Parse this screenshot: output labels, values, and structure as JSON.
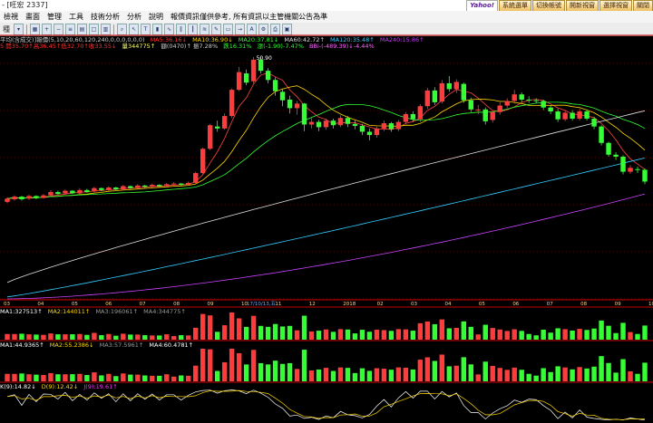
{
  "window": {
    "title": "- [旺宏 2337]"
  },
  "top_buttons": [
    "Yahoo!",
    "系統選單",
    "切換帳號",
    "開新視窗",
    "選擇視窗",
    "關閉"
  ],
  "menu": [
    "檢視",
    "畫面",
    "管理",
    "工具",
    "技術分析",
    "分析",
    "說明",
    "報價資訊僅供參考, 所有資訊以主管機關公告為準"
  ],
  "toolbar": {
    "combo_label": "種"
  },
  "indicator_lines": {
    "price_header": [
      {
        "text": "平均(含成交)]報價(5,10,20,60,120,240,0,0,0,0,0,0)",
        "color": "#cccccc"
      },
      {
        "text": "MA5:36.16↓",
        "color": "#ff3333"
      },
      {
        "text": "MA10:36.90↓",
        "color": "#ffd700"
      },
      {
        "text": "MA20:37.81↓",
        "color": "#33ff33"
      },
      {
        "text": "MA60:42.72↑",
        "color": "#dddddd"
      },
      {
        "text": "MA120:35.48↑",
        "color": "#33ccff"
      },
      {
        "text": "MA240:15.86↑",
        "color": "#cc33ff"
      }
    ],
    "quote_line": [
      {
        "text": "5 開35.70↑高36.45↑低32.70↑收33.55↓",
        "color": "#ff3333"
      },
      {
        "text": "量344775↑",
        "color": "#ffff66"
      },
      {
        "text": "額(0470)↑ 振7.28%",
        "color": "#cccccc"
      },
      {
        "text": "跌16.31%",
        "color": "#33ff33"
      },
      {
        "text": "漲(-1.90)-7.47%",
        "color": "#33ff33"
      },
      {
        "text": "BBi-(-489.39)↓-4.44%",
        "color": "#ff66ff"
      }
    ],
    "volume_header": [
      {
        "text": "MA1:327513↑",
        "color": "#ffffff"
      },
      {
        "text": "MA2:144011↑",
        "color": "#ffd700"
      },
      {
        "text": "MA3:196061↑",
        "color": "#999999"
      },
      {
        "text": "MA4:344775↑",
        "color": "#999999"
      }
    ],
    "second_header": [
      {
        "text": "MA1:44.9365↑",
        "color": "#ffffff"
      },
      {
        "text": "MA2:55.2386↓",
        "color": "#ffd700"
      },
      {
        "text": "MA3:57.5961↑",
        "color": "#999999"
      },
      {
        "text": "MA4:60.4781↑",
        "color": "#ffffff"
      }
    ],
    "kd_header": [
      {
        "text": "K(9):14.82↓",
        "color": "#ffffff"
      },
      {
        "text": "D(9):12.42↓",
        "color": "#ffd700"
      },
      {
        "text": "J(9):19.61↑",
        "color": "#ff33ff"
      }
    ]
  },
  "chart_data": {
    "type": "candlestick",
    "peak_label": "50.90",
    "date_axis": [
      "03",
      "04",
      "05",
      "06",
      "07",
      "08",
      "09",
      "10",
      "11",
      "12",
      "2018",
      "02",
      "03",
      "04",
      "05",
      "06",
      "07",
      "08",
      "09",
      "10"
    ],
    "cursor_label": "17/10/13,五",
    "candles": [
      {
        "o": 28.8,
        "c": 29.3,
        "h": 29.5,
        "l": 28.6
      },
      {
        "o": 29.2,
        "c": 29.6,
        "h": 29.8,
        "l": 29.0
      },
      {
        "o": 29.6,
        "c": 29.2,
        "h": 29.7,
        "l": 29.0
      },
      {
        "o": 29.3,
        "c": 29.7,
        "h": 29.9,
        "l": 29.1
      },
      {
        "o": 29.7,
        "c": 29.4,
        "h": 29.8,
        "l": 29.2
      },
      {
        "o": 29.4,
        "c": 29.8,
        "h": 30.0,
        "l": 29.3
      },
      {
        "o": 29.8,
        "c": 30.3,
        "h": 30.6,
        "l": 29.7
      },
      {
        "o": 30.3,
        "c": 30.0,
        "h": 30.5,
        "l": 29.9
      },
      {
        "o": 30.1,
        "c": 30.5,
        "h": 30.7,
        "l": 29.9
      },
      {
        "o": 30.5,
        "c": 30.1,
        "h": 30.6,
        "l": 30.0
      },
      {
        "o": 30.1,
        "c": 30.6,
        "h": 30.9,
        "l": 30.0
      },
      {
        "o": 30.6,
        "c": 30.3,
        "h": 30.8,
        "l": 30.2
      },
      {
        "o": 30.4,
        "c": 30.9,
        "h": 31.1,
        "l": 30.2
      },
      {
        "o": 30.9,
        "c": 30.6,
        "h": 31.0,
        "l": 30.4
      },
      {
        "o": 30.6,
        "c": 31.0,
        "h": 31.2,
        "l": 30.5
      },
      {
        "o": 31.0,
        "c": 30.7,
        "h": 31.1,
        "l": 30.6
      },
      {
        "o": 30.7,
        "c": 31.2,
        "h": 31.4,
        "l": 30.6
      },
      {
        "o": 31.2,
        "c": 30.9,
        "h": 31.3,
        "l": 30.8
      },
      {
        "o": 30.9,
        "c": 31.3,
        "h": 31.5,
        "l": 30.8
      },
      {
        "o": 31.3,
        "c": 31.1,
        "h": 31.4,
        "l": 30.9
      },
      {
        "o": 31.1,
        "c": 31.4,
        "h": 31.6,
        "l": 31.0
      },
      {
        "o": 31.4,
        "c": 31.2,
        "h": 31.5,
        "l": 31.0
      },
      {
        "o": 31.2,
        "c": 31.5,
        "h": 31.7,
        "l": 31.1
      },
      {
        "o": 31.5,
        "c": 31.6,
        "h": 31.8,
        "l": 31.3
      },
      {
        "o": 31.6,
        "c": 31.4,
        "h": 31.7,
        "l": 31.2
      },
      {
        "o": 31.4,
        "c": 31.7,
        "h": 31.9,
        "l": 31.3
      },
      {
        "o": 31.7,
        "c": 33.2,
        "h": 33.4,
        "l": 31.6
      },
      {
        "o": 33.2,
        "c": 36.9,
        "h": 37.1,
        "l": 33.0
      },
      {
        "o": 36.9,
        "c": 40.5,
        "h": 40.7,
        "l": 36.7
      },
      {
        "o": 40.3,
        "c": 40.0,
        "h": 41.2,
        "l": 39.5
      },
      {
        "o": 40.0,
        "c": 41.9,
        "h": 42.3,
        "l": 39.8
      },
      {
        "o": 41.9,
        "c": 45.9,
        "h": 46.1,
        "l": 41.6
      },
      {
        "o": 45.9,
        "c": 48.6,
        "h": 49.4,
        "l": 45.7
      },
      {
        "o": 48.4,
        "c": 47.0,
        "h": 49.0,
        "l": 46.6
      },
      {
        "o": 47.2,
        "c": 50.5,
        "h": 50.9,
        "l": 46.9
      },
      {
        "o": 50.5,
        "c": 48.8,
        "h": 50.9,
        "l": 48.4
      },
      {
        "o": 48.8,
        "c": 47.4,
        "h": 49.2,
        "l": 46.9
      },
      {
        "o": 47.4,
        "c": 45.7,
        "h": 47.8,
        "l": 45.0
      },
      {
        "o": 45.6,
        "c": 44.3,
        "h": 46.1,
        "l": 43.4
      },
      {
        "o": 44.4,
        "c": 43.1,
        "h": 45.0,
        "l": 42.3
      },
      {
        "o": 43.1,
        "c": 43.8,
        "h": 44.2,
        "l": 42.1
      },
      {
        "o": 43.8,
        "c": 40.6,
        "h": 43.9,
        "l": 39.6
      },
      {
        "o": 40.6,
        "c": 41.0,
        "h": 41.6,
        "l": 40.0
      },
      {
        "o": 41.0,
        "c": 40.2,
        "h": 41.3,
        "l": 39.6
      },
      {
        "o": 40.2,
        "c": 41.2,
        "h": 41.5,
        "l": 39.8
      },
      {
        "o": 41.2,
        "c": 40.5,
        "h": 41.5,
        "l": 40.0
      },
      {
        "o": 40.5,
        "c": 41.6,
        "h": 42.0,
        "l": 40.2
      },
      {
        "o": 41.6,
        "c": 40.7,
        "h": 41.9,
        "l": 40.2
      },
      {
        "o": 40.7,
        "c": 40.4,
        "h": 41.2,
        "l": 39.9
      },
      {
        "o": 40.4,
        "c": 39.5,
        "h": 40.7,
        "l": 39.0
      },
      {
        "o": 39.5,
        "c": 39.0,
        "h": 40.0,
        "l": 38.2
      },
      {
        "o": 39.0,
        "c": 40.0,
        "h": 40.3,
        "l": 38.6
      },
      {
        "o": 40.0,
        "c": 40.8,
        "h": 41.2,
        "l": 39.6
      },
      {
        "o": 40.8,
        "c": 39.9,
        "h": 41.0,
        "l": 39.5
      },
      {
        "o": 39.9,
        "c": 41.0,
        "h": 41.3,
        "l": 39.6
      },
      {
        "o": 41.0,
        "c": 42.2,
        "h": 42.5,
        "l": 40.7
      },
      {
        "o": 42.2,
        "c": 41.4,
        "h": 42.6,
        "l": 41.0
      },
      {
        "o": 41.4,
        "c": 43.4,
        "h": 43.7,
        "l": 41.0
      },
      {
        "o": 43.4,
        "c": 45.8,
        "h": 46.2,
        "l": 43.0
      },
      {
        "o": 45.8,
        "c": 44.0,
        "h": 46.3,
        "l": 43.6
      },
      {
        "o": 44.1,
        "c": 46.9,
        "h": 47.4,
        "l": 43.8
      },
      {
        "o": 46.9,
        "c": 46.0,
        "h": 48.0,
        "l": 45.6
      },
      {
        "o": 46.0,
        "c": 47.1,
        "h": 47.5,
        "l": 45.4
      },
      {
        "o": 46.8,
        "c": 44.3,
        "h": 47.0,
        "l": 43.9
      },
      {
        "o": 44.3,
        "c": 42.9,
        "h": 44.7,
        "l": 42.5
      },
      {
        "o": 42.9,
        "c": 42.9,
        "h": 43.6,
        "l": 42.2
      },
      {
        "o": 42.9,
        "c": 41.1,
        "h": 43.2,
        "l": 40.6
      },
      {
        "o": 41.3,
        "c": 42.5,
        "h": 42.8,
        "l": 40.9
      },
      {
        "o": 42.5,
        "c": 43.5,
        "h": 44.0,
        "l": 42.1
      },
      {
        "o": 43.5,
        "c": 44.2,
        "h": 44.6,
        "l": 43.1
      },
      {
        "o": 44.2,
        "c": 45.2,
        "h": 45.9,
        "l": 43.8
      },
      {
        "o": 45.2,
        "c": 44.4,
        "h": 45.5,
        "l": 44.0
      },
      {
        "o": 44.4,
        "c": 44.3,
        "h": 44.9,
        "l": 43.9
      },
      {
        "o": 44.3,
        "c": 44.2,
        "h": 44.6,
        "l": 43.8
      },
      {
        "o": 44.2,
        "c": 43.2,
        "h": 44.4,
        "l": 42.8
      },
      {
        "o": 43.2,
        "c": 42.6,
        "h": 43.5,
        "l": 42.2
      },
      {
        "o": 42.6,
        "c": 41.4,
        "h": 43.0,
        "l": 41.0
      },
      {
        "o": 41.4,
        "c": 42.4,
        "h": 42.8,
        "l": 41.1
      },
      {
        "o": 42.4,
        "c": 41.5,
        "h": 42.8,
        "l": 41.2
      },
      {
        "o": 41.5,
        "c": 42.6,
        "h": 43.0,
        "l": 41.2
      },
      {
        "o": 42.6,
        "c": 41.5,
        "h": 42.9,
        "l": 41.2
      },
      {
        "o": 41.5,
        "c": 40.3,
        "h": 41.8,
        "l": 39.9
      },
      {
        "o": 40.3,
        "c": 37.8,
        "h": 40.5,
        "l": 37.4
      },
      {
        "o": 37.8,
        "c": 36.0,
        "h": 38.0,
        "l": 35.7
      },
      {
        "o": 36.0,
        "c": 35.7,
        "h": 36.4,
        "l": 35.2
      },
      {
        "o": 35.7,
        "c": 33.4,
        "h": 35.9,
        "l": 33.0
      },
      {
        "o": 33.4,
        "c": 34.0,
        "h": 34.4,
        "l": 33.1
      },
      {
        "o": 33.8,
        "c": 33.7,
        "h": 34.2,
        "l": 33.2
      },
      {
        "o": 33.7,
        "c": 31.9,
        "h": 33.9,
        "l": 31.5
      }
    ],
    "volume_series": "derived-from-candles",
    "kd_series": "derived-from-candles"
  },
  "colors": {
    "up": "#ff3b3b",
    "down": "#33ff33",
    "grid": "#a00000",
    "axis": "#c80000"
  }
}
